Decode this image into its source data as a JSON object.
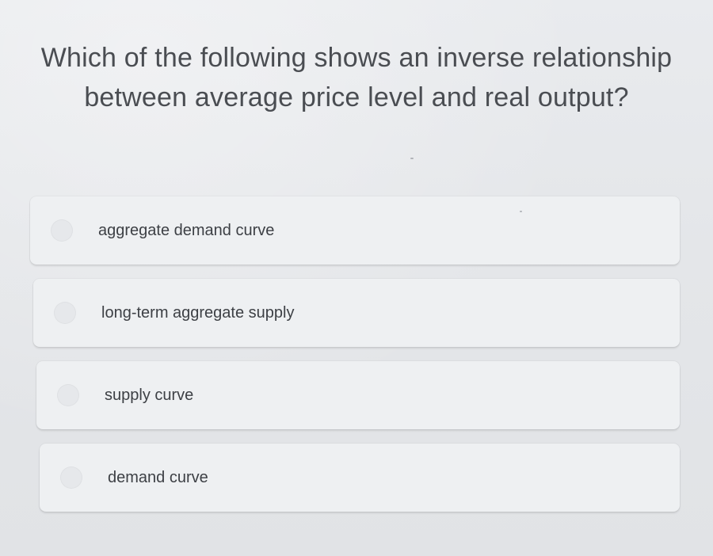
{
  "question": {
    "line1": "Which of the following shows an inverse relationship",
    "line2": "between average price level and real output?"
  },
  "options": [
    {
      "label": "aggregate demand curve",
      "selected": false
    },
    {
      "label": "long-term aggregate supply",
      "selected": false
    },
    {
      "label": "supply curve",
      "selected": false
    },
    {
      "label": "demand curve",
      "selected": false
    }
  ],
  "colors": {
    "background": "#e4e6e9",
    "card": "#eef0f2",
    "text": "#3d4045",
    "question_text": "#4a4d52"
  }
}
